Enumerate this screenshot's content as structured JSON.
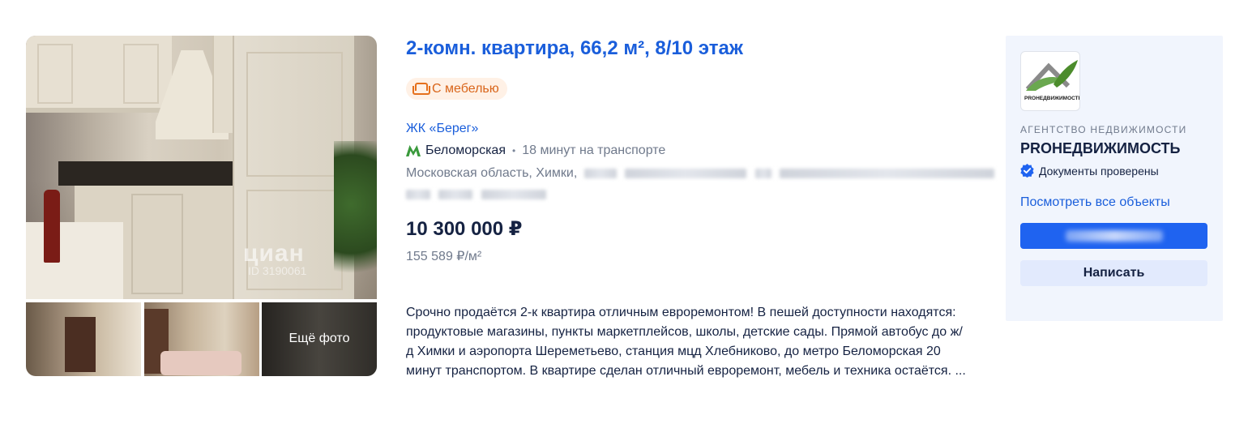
{
  "listing": {
    "title": "2-комн. квартира, 66,2 м², 8/10 этаж",
    "badge": "С мебелью",
    "complex": "ЖК «Берег»",
    "metro": {
      "name": "Беломорская",
      "separator": "•",
      "time": "18 минут на транспорте",
      "color": "#3a9a3c"
    },
    "address_visible": "Московская область, Химки,",
    "price": "10 300 000 ₽",
    "price_per_m2": "155 589 ₽/м²",
    "description": [
      "Срочно продаётся 2-к квартира отличным евроремонтом! В пешей доступности находятся:",
      "продуктовые магазины, пункты маркетплейсов, школы, детские сады. Прямой автобус до ж/",
      "д Химки и аэропорта Шереметьево, станция мцд Хлебниково, до метро Беломорская 20",
      "минут транспортом. В квартире сделан отличный евроремонт, мебель и техника остаётся. ..."
    ]
  },
  "photos": {
    "watermark": "циан",
    "watermark_id": "ID 3190061",
    "more_label": "Ещё фото"
  },
  "agency": {
    "logo_text": "PROНЕДВИЖИМОСТЬ",
    "type": "АГЕНТСТВО НЕДВИЖИМОСТИ",
    "name": "PROНЕДВИЖИМОСТЬ",
    "verified": "Документы проверены",
    "all_objects_link": "Посмотреть все объекты",
    "write_button": "Написать",
    "accent_color": "#1f63f0"
  },
  "colors": {
    "link": "#1a5edb",
    "text": "#152242",
    "muted": "#707a8c",
    "badge_bg": "#fff1e6",
    "badge_text": "#d9651a",
    "panel_bg": "#f1f5fd"
  }
}
